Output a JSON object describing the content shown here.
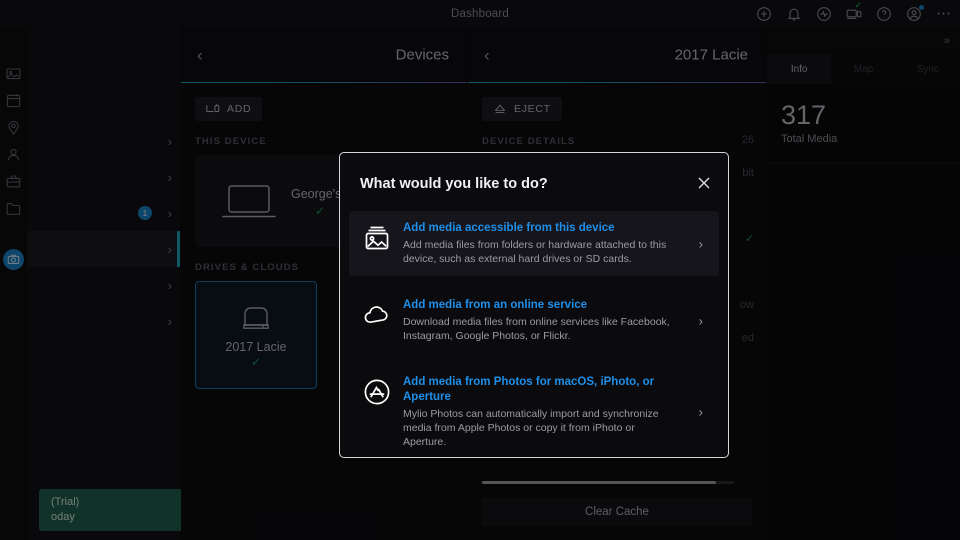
{
  "topbar": {
    "title": "Dashboard",
    "icons": [
      {
        "name": "add-circle-icon",
        "glyph": "plus-circle"
      },
      {
        "name": "notification-bell-icon",
        "glyph": "bell"
      },
      {
        "name": "activity-icon",
        "glyph": "activity"
      },
      {
        "name": "devices-icon",
        "glyph": "devices",
        "badge": "check",
        "badge_color": "#1db954"
      },
      {
        "name": "help-icon",
        "glyph": "question-circle"
      },
      {
        "name": "account-icon",
        "glyph": "person-circle",
        "badge": "dot",
        "badge_color": "#1a7fc1"
      },
      {
        "name": "more-options-icon",
        "glyph": "ellipsis"
      }
    ]
  },
  "rail": {
    "items": [
      {
        "name": "photos-icon",
        "glyph": "photo",
        "active": false
      },
      {
        "name": "calendar-icon",
        "glyph": "calendar",
        "active": false
      },
      {
        "name": "places-icon",
        "glyph": "pin",
        "active": false
      },
      {
        "name": "people-icon",
        "glyph": "person",
        "active": false
      },
      {
        "name": "briefcase-icon",
        "glyph": "briefcase",
        "active": false
      },
      {
        "name": "folders-icon",
        "glyph": "folder",
        "active": false
      },
      {
        "name": "devices-icon",
        "glyph": "camera-device",
        "active": true
      }
    ]
  },
  "navcol": {
    "rows": [
      {
        "chevron": "›",
        "badge": null,
        "selected": false
      },
      {
        "chevron": "›",
        "badge": null,
        "selected": false
      },
      {
        "chevron": "›",
        "badge": "1",
        "selected": false
      },
      {
        "chevron": "›",
        "badge": null,
        "selected": true
      },
      {
        "chevron": "›",
        "badge": null,
        "selected": false
      },
      {
        "chevron": "›",
        "badge": null,
        "selected": false
      }
    ],
    "trial": {
      "line1": "(Trial)",
      "line2": "oday",
      "icon": "external-link-icon",
      "color": "#1e5c49"
    }
  },
  "devices_panel": {
    "back": "‹",
    "title": "Devices",
    "add_button": {
      "label": "ADD",
      "icon": "add-device-icon"
    },
    "this_device_label": "THIS DEVICE",
    "this_device": {
      "name": "George's",
      "icon": "laptop-icon",
      "status": "✓"
    },
    "drives_label": "DRIVES & CLOUDS",
    "drive": {
      "name": "2017 Lacie",
      "icon": "hard-drive-icon",
      "status": "✓",
      "selected": true
    }
  },
  "detail_panel": {
    "back": "‹",
    "title": "2017 Lacie",
    "eject_button": {
      "label": "EJECT",
      "icon": "eject-icon"
    },
    "details_label": "DEVICE DETAILS",
    "obscured_rows": [
      {
        "value": "26"
      },
      {
        "value": "bit"
      },
      {
        "value": ""
      },
      {
        "value": "✓"
      },
      {
        "value": ""
      },
      {
        "value": "ow"
      },
      {
        "value": "ed"
      }
    ],
    "clear_cache": "Clear Cache",
    "progress_percent": 93
  },
  "right_panel": {
    "collapse_icon": "»",
    "tabs": [
      {
        "label": "Info",
        "active": true
      },
      {
        "label": "Map",
        "active": false
      },
      {
        "label": "Sync",
        "active": false
      }
    ],
    "stat_value": "317",
    "stat_label": "Total Media"
  },
  "modal": {
    "title": "What would you like to do?",
    "close_icon": "✕",
    "options": [
      {
        "icon": "photo-stack-icon",
        "title": "Add media accessible from this device",
        "description": "Add media files from folders or hardware attached to this device, such as external hard drives or SD cards.",
        "chevron": "›",
        "hover": true
      },
      {
        "icon": "cloud-icon",
        "title": "Add media from an online service",
        "description": "Download media files from online services like Facebook, Instagram, Google Photos, or Flickr.",
        "chevron": "›",
        "hover": false
      },
      {
        "icon": "app-store-icon",
        "title": "Add media from Photos for macOS, iPhoto, or Aperture",
        "description": "Mylio Photos can automatically import and synchronize media from Apple Photos or copy it from iPhoto or Aperture.",
        "chevron": "›",
        "hover": false
      }
    ]
  },
  "colors": {
    "accent_blue": "#1f8fe8",
    "rail_active": "#1a7fc1",
    "teal": "#17a2b8",
    "purple": "#6b4fa8",
    "green": "#1e5c49",
    "background": "#0a0a0c"
  }
}
